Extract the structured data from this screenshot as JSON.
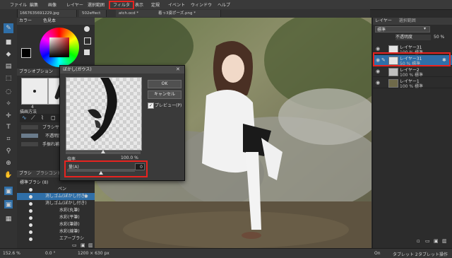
{
  "menu": {
    "items": [
      "ファイル",
      "編集",
      "画像",
      "レイヤー",
      "選択範囲",
      "フィルタ",
      "表示",
      "定規",
      "イベント",
      "ウィンドウ",
      "ヘルプ"
    ],
    "highlighted": "フィルタ"
  },
  "tabs": [
    "1667635691229.jpg",
    "502effect",
    "atch.ocd *",
    "着っ3姿ポーズ.png *"
  ],
  "left": {
    "color_header": "カラー",
    "color_tab": "色見本",
    "brush_option_header": "ブラシオプション",
    "brush_size": "4",
    "drawing_method": "描画方法",
    "brush_size_label": "ブラシサイズ",
    "opacity_label": "不透明度",
    "stabilizer_label": "手振れ補正",
    "brush_header": "ブラシ",
    "brush_control_tab": "ブラシコントロール",
    "brush_group": "標準ブラシ (8)",
    "brushes": [
      "ペン",
      "消しゴム(ぼかし付き)",
      "消しゴム(ぼかし付き)",
      "水彩(丸筆)",
      "水彩(平筆)",
      "水彩(筆跡)",
      "水彩(線筆)",
      "エアーブラシ"
    ]
  },
  "dialog": {
    "title": "ぼかし(ガウス)",
    "ok": "OK",
    "cancel": "キャンセル",
    "preview_label": "プレビュー(P)",
    "preview_checked": true,
    "zoom_label": "倍率",
    "zoom_value": "100.0 %",
    "amount_label": "量(A)",
    "amount_value": "0"
  },
  "layers": {
    "tabs": [
      "レイヤー",
      "選択範囲"
    ],
    "blend": "標準",
    "opacity_label": "不透明度",
    "opacity_value": "50 %",
    "items": [
      {
        "name": "レイヤー31",
        "sub": "100 % 標準",
        "selected": false
      },
      {
        "name": "レイヤー31",
        "sub": "50 % 標準",
        "selected": true
      },
      {
        "name": "レイヤー2",
        "sub": "100 % 標準",
        "selected": false
      },
      {
        "name": "レイヤー1",
        "sub": "100 % 標準",
        "selected": false
      }
    ]
  },
  "status": {
    "zoom": "152.6 %",
    "angle": "0.0 °",
    "size": "1200 × 630 px",
    "tablet": "タブレット 2",
    "tablet2": "タブレット操作",
    "on": "On"
  },
  "colors": {
    "accent": "#2f6fa8",
    "highlight_box": "#e8231f"
  }
}
